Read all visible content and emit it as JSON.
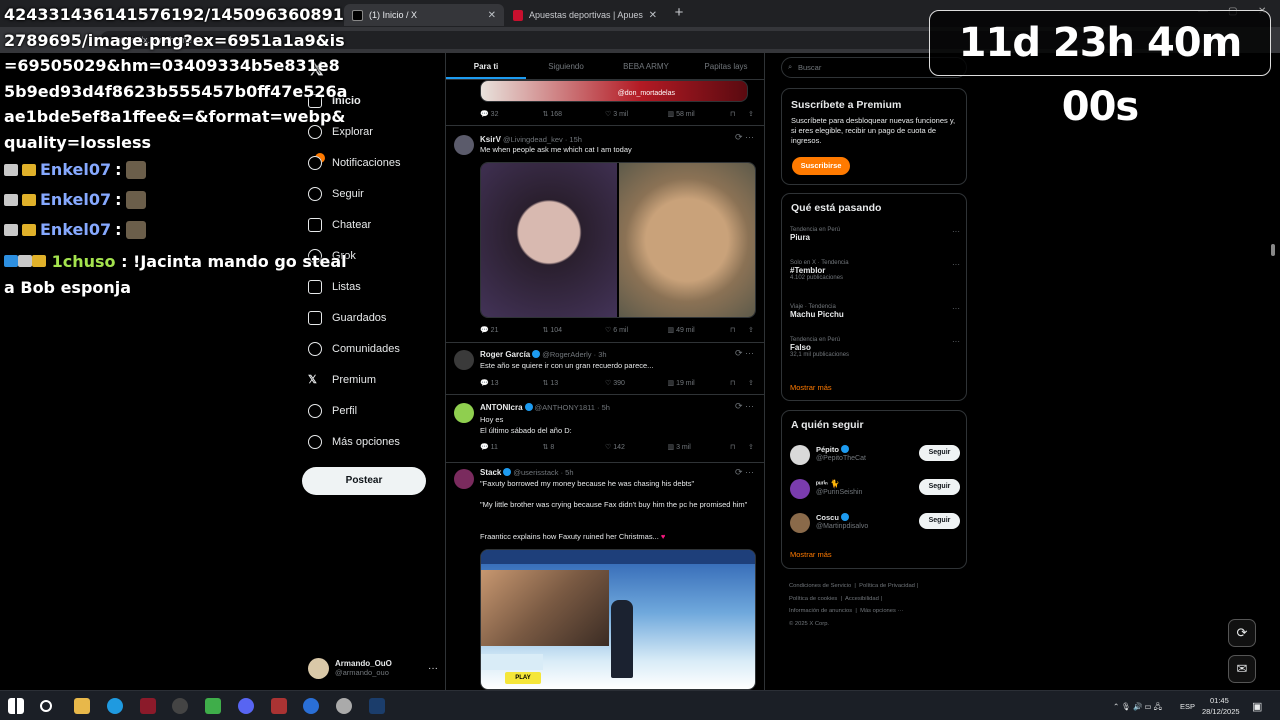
{
  "browser": {
    "tabs": [
      {
        "label": "(1) Inicio / X",
        "active": true
      },
      {
        "label": "Apuestas deportivas | Apuestas on",
        "active": false
      }
    ],
    "url": "https://x.com/home"
  },
  "overlay": {
    "url_text": "424331436141576192/1450963608912789695/image.png?ex=6951a1a9&is=69505029&hm=03409334b5e831e85b9ed93d4f8623b555457b0ff47e526aae1bde5ef8a1ffee&=&format=webp&quality=lossless",
    "chat": [
      {
        "user": "Enkel07",
        "sep": ":"
      },
      {
        "user": "Enkel07",
        "sep": ":"
      },
      {
        "user": "Enkel07",
        "sep": ":"
      }
    ],
    "last_user": "1chuso",
    "last_message": ": !Jacinta mando go steal a Bob esponja",
    "countdown": "11d 23h 40m 00s"
  },
  "nav": {
    "items": [
      {
        "label": "Inicio",
        "icon": "home-icon"
      },
      {
        "label": "Explorar",
        "icon": "search-icon"
      },
      {
        "label": "Notificaciones",
        "icon": "bell-icon"
      },
      {
        "label": "Seguir",
        "icon": "person-add-icon"
      },
      {
        "label": "Chatear",
        "icon": "mail-icon"
      },
      {
        "label": "Grok",
        "icon": "grok-icon"
      },
      {
        "label": "Listas",
        "icon": "list-icon"
      },
      {
        "label": "Guardados",
        "icon": "bookmark-icon"
      },
      {
        "label": "Comunidades",
        "icon": "people-icon"
      },
      {
        "label": "Premium",
        "icon": "x-icon"
      },
      {
        "label": "Perfil",
        "icon": "person-icon"
      },
      {
        "label": "Más opciones",
        "icon": "more-circle-icon"
      }
    ],
    "post_label": "Postear",
    "profile_name": "Armando_OuO",
    "profile_handle": "@armando_ouo"
  },
  "feed": {
    "tabs": [
      "Para ti",
      "Siguiendo",
      "BEBA ARMY",
      "Papitas lays"
    ],
    "top_stats": [
      "32",
      "168",
      "3 mil",
      "58 mil"
    ],
    "top_caption": "@don_mortadelas",
    "tweets": [
      {
        "name": "KsirV",
        "handle": "@Livingdead_kev · 15h",
        "text": "Me when people ask me which cat I am today",
        "stats": [
          "21",
          "104",
          "6 mil",
          "49 mil"
        ]
      },
      {
        "name": "Roger García",
        "handle": "@RogerAderly · 3h",
        "text": "Este año se quiere ir con un gran recuerdo parece...",
        "stats": [
          "13",
          "13",
          "390",
          "19 mil"
        ]
      },
      {
        "name": "ANTONIcra",
        "handle": "@ANTHONY1811 · 5h",
        "text": "Hoy es",
        "text2": "El último sábado del año D:",
        "stats": [
          "11",
          "8",
          "142",
          "3 mil"
        ]
      },
      {
        "name": "Stack",
        "handle": "@userisstack · 5h",
        "text": "\"Faxuty borrowed my money because he was chasing his debts\"",
        "text2": "\"My little brother was crying because Fax didn't buy him the pc he promised him\"",
        "text3": "Fraanticc explains how Faxuty ruined her Christmas...",
        "play": "PLAY"
      }
    ]
  },
  "sidebar": {
    "search_placeholder": "Buscar",
    "premium_title": "Suscríbete a Premium",
    "premium_text": "Suscríbete para desbloquear nuevas funciones y, si eres elegible, recibir un pago de cuota de ingresos.",
    "premium_button": "Suscribirse",
    "trends_title": "Qué está pasando",
    "trends": [
      {
        "context": "Tendencia en Perú",
        "title": "Piura",
        "count": ""
      },
      {
        "context": "Solo en X · Tendencia",
        "title": "#Temblor",
        "count": "4.102 publicaciones"
      },
      {
        "context": "Viaje · Tendencia",
        "title": "Machu Picchu",
        "count": ""
      },
      {
        "context": "Tendencia en Perú",
        "title": "Falso",
        "count": "32,1 mil publicaciones"
      }
    ],
    "show_more": "Mostrar más",
    "follow_title": "A quién seguir",
    "follow": [
      {
        "name": "Pépito",
        "handle": "@PepitoTheCat",
        "button": "Seguir"
      },
      {
        "name": "ᵖᵘʳⁱⁿ 🐈",
        "handle": "@PurinSeishin",
        "button": "Seguir"
      },
      {
        "name": "Coscu",
        "handle": "@Martinpdisalvo",
        "button": "Seguir"
      }
    ],
    "footer": [
      "Condiciones de Servicio",
      "Política de Privacidad",
      "Política de cookies",
      "Accesibilidad",
      "Información de anuncios",
      "Más opciones ···",
      "© 2025 X Corp."
    ]
  },
  "taskbar": {
    "language": "ESP",
    "time": "01:45",
    "date": "28/12/2025"
  },
  "colors": {
    "accent": "#ff7a00",
    "verified": "#1d9bf0",
    "background": "#000000"
  }
}
